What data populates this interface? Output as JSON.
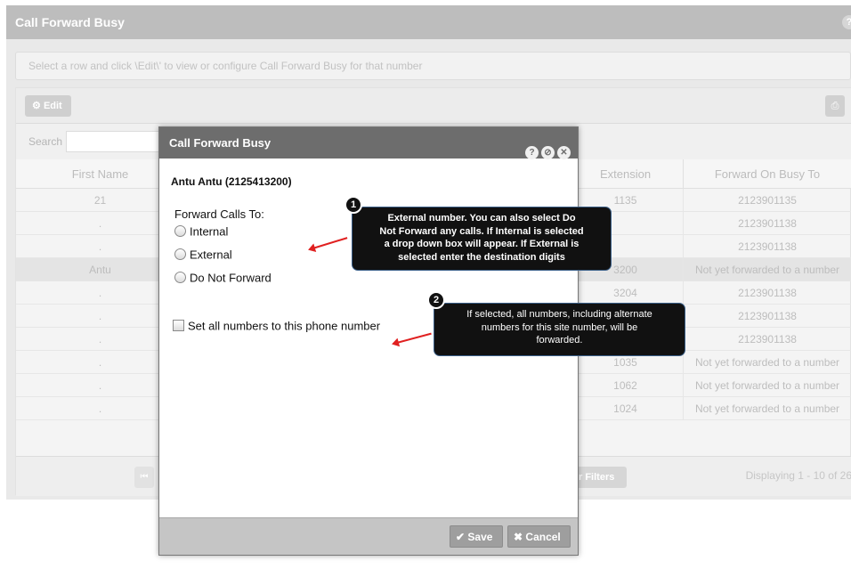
{
  "panel": {
    "title": "Call Forward Busy",
    "help_glyph": "?",
    "hint": "Select a row and click \\Edit\\' to view or configure Call Forward Busy for that number"
  },
  "toolbar": {
    "edit_label": "Edit",
    "edit_glyph": "⚙",
    "print_glyph": "⎙"
  },
  "search": {
    "label": "Search",
    "value": ""
  },
  "table": {
    "columns": [
      "First Name",
      "Extension",
      "Forward On Busy To"
    ],
    "rows": [
      {
        "first_name": "21",
        "extension": "1135",
        "forward_to": "2123901135"
      },
      {
        "first_name": ".",
        "extension": "",
        "forward_to": "2123901138"
      },
      {
        "first_name": ".",
        "extension": "",
        "forward_to": "2123901138"
      },
      {
        "first_name": "Antu",
        "extension": "3200",
        "forward_to": "Not yet forwarded to a number"
      },
      {
        "first_name": ".",
        "extension": "3204",
        "forward_to": "2123901138"
      },
      {
        "first_name": ".",
        "extension": "",
        "forward_to": "2123901138"
      },
      {
        "first_name": ".",
        "extension": "",
        "forward_to": "2123901138"
      },
      {
        "first_name": ".",
        "extension": "1035",
        "forward_to": "Not yet forwarded to a number"
      },
      {
        "first_name": ".",
        "extension": "1062",
        "forward_to": "Not yet forwarded to a number"
      },
      {
        "first_name": ".",
        "extension": "1024",
        "forward_to": "Not yet forwarded to a number"
      }
    ]
  },
  "pager": {
    "first_glyph": "⏮",
    "clear_filters": "r Filters",
    "displaying": "Displaying 1 - 10 of 26"
  },
  "modal": {
    "title": "Call Forward Busy",
    "icons": [
      "?",
      "⊘",
      "✕"
    ],
    "subscriber": "Antu Antu (2125413200)",
    "forward_label": "Forward Calls To:",
    "options": [
      "Internal",
      "External",
      "Do Not Forward"
    ],
    "set_all_label": "Set all numbers to this phone number",
    "save_label": "Save",
    "save_glyph": "✔",
    "cancel_label": "Cancel",
    "cancel_glyph": "✖"
  },
  "callouts": [
    {
      "number": "1",
      "lines": [
        "External number.  You can also select Do",
        "Not Forward any calls.  If Internal is selected",
        "a drop down box will appear.  If External is",
        "selected enter the destination digits"
      ]
    },
    {
      "number": "2",
      "lines": [
        "If selected, all numbers, including alternate",
        "numbers for this site number, will be",
        "forwarded."
      ]
    }
  ],
  "colors": {
    "modal_header": "#6d6d6d",
    "arrow": "#e02020",
    "callout_bg": "#111111"
  }
}
